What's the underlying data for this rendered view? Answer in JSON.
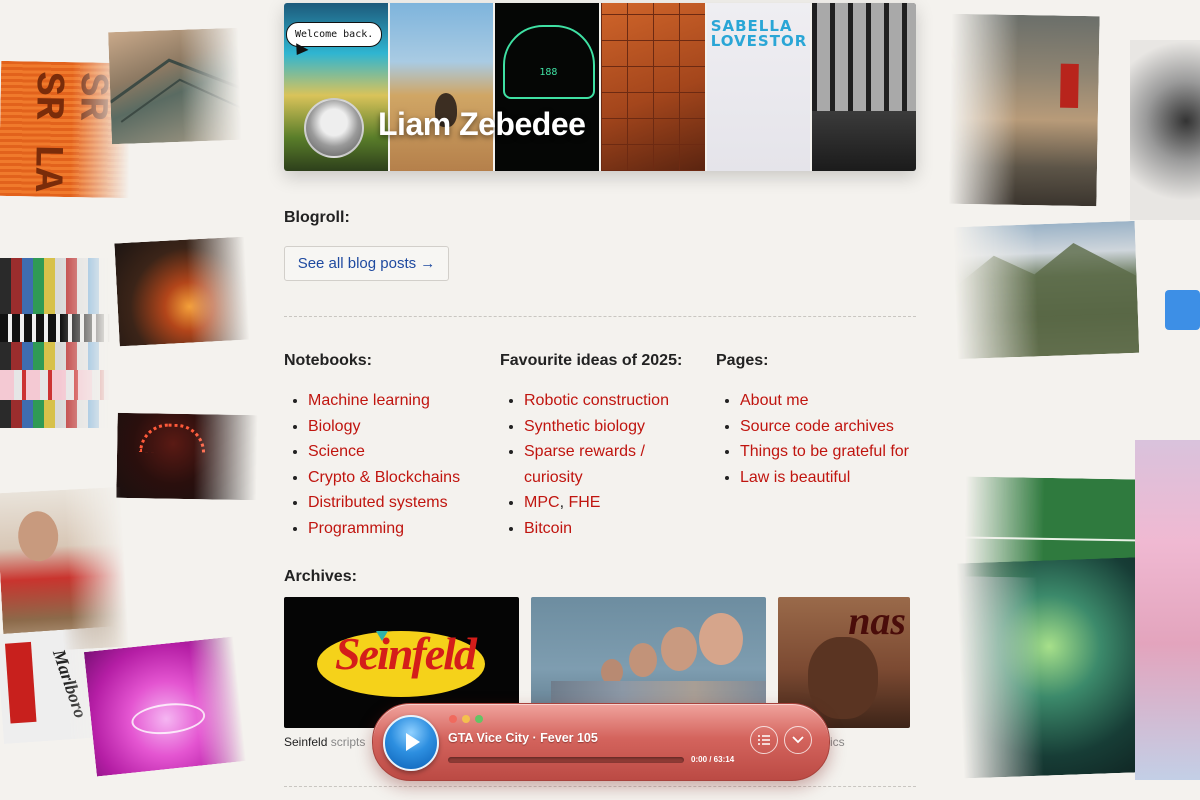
{
  "header": {
    "speech_bubble": "Welcome back.",
    "site_title": "Liam Zebedee",
    "tile_text": "SABELLA LOVESTOR",
    "dashboard_reading": "188"
  },
  "blogroll": {
    "heading": "Blogroll:",
    "see_all_label": "See all blog posts →"
  },
  "notebooks": {
    "heading": "Notebooks:",
    "items": [
      "Machine learning",
      "Biology",
      "Science",
      "Crypto & Blockchains",
      "Distributed systems",
      "Programming"
    ]
  },
  "ideas": {
    "heading": "Favourite ideas of 2025:",
    "items": [
      "Robotic construction",
      "Synthetic biology",
      "Sparse rewards / curiosity",
      "MPC",
      "FHE",
      "Bitcoin"
    ],
    "mpc_fhe_separator": ", "
  },
  "pages": {
    "heading": "Pages:",
    "items": [
      "About me",
      "Source code archives",
      "Things to be grateful for",
      "Law is beautiful"
    ]
  },
  "archives": {
    "heading": "Archives:",
    "items": [
      {
        "logo_text": "Seinfeld",
        "caption_title": "Seinfeld",
        "caption_rest": "scripts"
      },
      {
        "caption_title": "",
        "caption_rest": ""
      },
      {
        "logo_text": "nas",
        "caption_title": "",
        "caption_rest": "ics"
      }
    ]
  },
  "player": {
    "track_title": "GTA Vice City · Fever 105",
    "time": "0:00 / 63:14",
    "progress": 0,
    "window_dot_colors": [
      "#f06a5e",
      "#f4c04e",
      "#64c365"
    ],
    "accent": "#cf5c55"
  },
  "decor": {
    "orange_card_text": "SR\nSR\nLA A",
    "marlboro_text": "Marlboro"
  },
  "colors": {
    "link": "#c0150f",
    "button_text": "#1f4aa0",
    "background": "#f4f2ee"
  },
  "icons": {
    "play": "play-icon",
    "playlist": "list-icon",
    "collapse": "chevron-down-icon"
  }
}
